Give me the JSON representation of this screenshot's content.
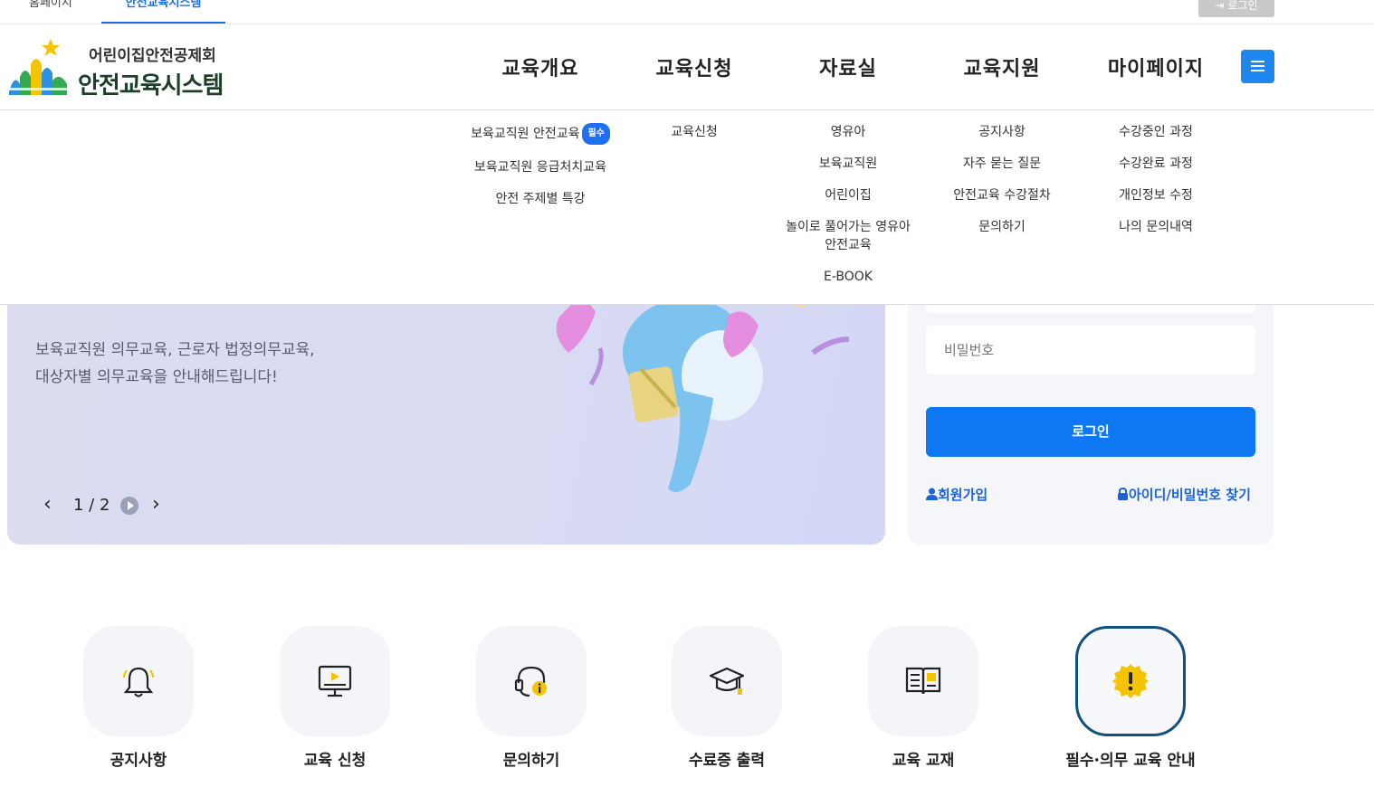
{
  "topbar": {
    "home_tab": "홈페이지",
    "active_tab": "안전교육시스템",
    "login": "로그인"
  },
  "logo": {
    "subtitle": "어린이집안전공제회",
    "title": "안전교육시스템"
  },
  "gnb": [
    "교육개요",
    "교육신청",
    "자료실",
    "교육지원",
    "마이페이지"
  ],
  "dropdown": {
    "col1": [
      "보육교직원 안전교육",
      "보육교직원 응급처치교육",
      "안전 주제별 특강"
    ],
    "col1_badge": "필수",
    "col2": [
      "교육신청"
    ],
    "col3": [
      "영유아",
      "보육교직원",
      "어린이집",
      "놀이로 풀어가는 영유아 안전교육",
      "E-BOOK"
    ],
    "col4": [
      "공지사항",
      "자주 묻는 질문",
      "안전교육 수강절차",
      "문의하기"
    ],
    "col5": [
      "수강중인 과정",
      "수강완료 과정",
      "개인정보 수정",
      "나의 문의내역"
    ]
  },
  "banner": {
    "desc_line1": "보육교직원 의무교육, 근로자 법정의무교육,",
    "desc_line2": "대상자별 의무교육을 안내해드립니다!",
    "counter": "1 / 2"
  },
  "login": {
    "password_placeholder": "비밀번호",
    "button": "로그인",
    "signup": "회원가입",
    "find": "아이디/비밀번호 찾기"
  },
  "quick_links": [
    {
      "label": "공지사항",
      "icon": "bell-icon"
    },
    {
      "label": "교육 신청",
      "icon": "monitor-play-icon"
    },
    {
      "label": "문의하기",
      "icon": "headset-icon"
    },
    {
      "label": "수료증 출력",
      "icon": "graduation-cap-icon"
    },
    {
      "label": "교육 교재",
      "icon": "book-icon"
    },
    {
      "label": "필수·의무 교육 안내",
      "icon": "alert-badge-icon"
    }
  ],
  "colors": {
    "accent": "#0d78f2",
    "menu_button": "#1f87f0",
    "badge": "#1f6ff2",
    "highlight_border": "#14507e",
    "icon_yellow": "#f5c400"
  }
}
